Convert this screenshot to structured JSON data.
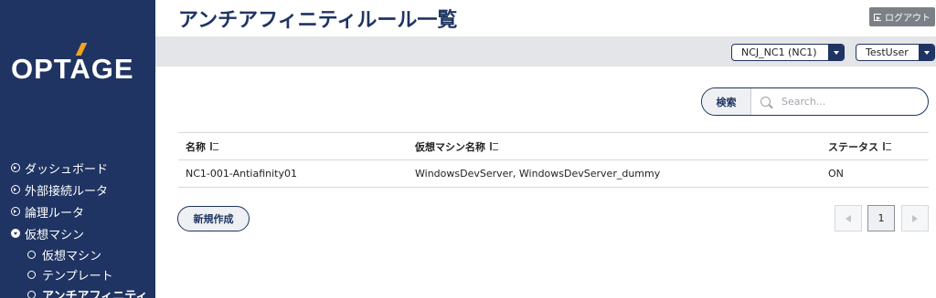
{
  "app": {
    "logo_text": "OPTAGE"
  },
  "page": {
    "title": "アンチアフィニティルール一覧"
  },
  "header": {
    "logout_label": "ログアウト"
  },
  "toolbar": {
    "project_select": "NCJ_NC1 (NC1)",
    "user_select": "TestUser"
  },
  "sidebar": {
    "items": [
      {
        "label": "ダッシュボード"
      },
      {
        "label": "外部接続ルータ"
      },
      {
        "label": "論理ルータ"
      },
      {
        "label": "仮想マシン"
      }
    ],
    "sub_items": [
      {
        "label": "仮想マシン"
      },
      {
        "label": "テンプレート"
      },
      {
        "label": "アンチアフィニティ"
      }
    ]
  },
  "search": {
    "button_label": "検索",
    "placeholder": "Search..."
  },
  "table": {
    "columns": [
      "名称",
      "仮想マシン名称",
      "ステータス"
    ],
    "rows": [
      {
        "name": "NC1-001-Antiafinity01",
        "vms": "WindowsDevServer, WindowsDevServer_dummy",
        "status": "ON"
      }
    ]
  },
  "actions": {
    "create_label": "新規作成"
  },
  "pagination": {
    "current_page": "1"
  },
  "colors": {
    "sidebar": "#1f3462",
    "accent": "#f2a21f",
    "toolbar": "#e3e5e8"
  }
}
